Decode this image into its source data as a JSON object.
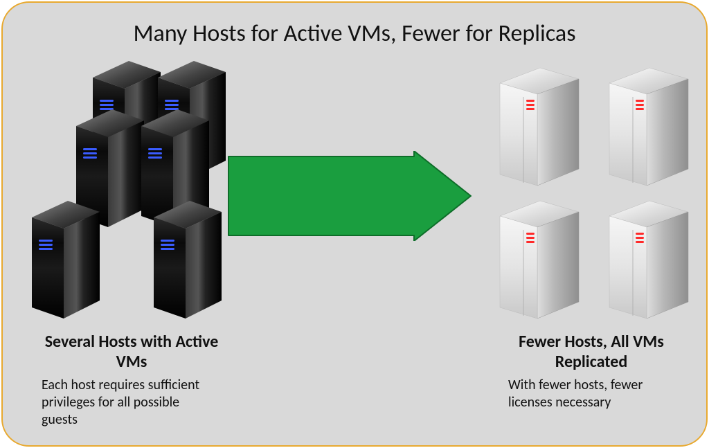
{
  "title": "Many Hosts for Active VMs, Fewer for Replicas",
  "left": {
    "heading": "Several Hosts with Active VMs",
    "sub": "Each host requires sufficient privileges for all possible guests"
  },
  "right": {
    "heading": "Fewer Hosts, All VMs Replicated",
    "sub": "With fewer hosts, fewer licenses necessary"
  },
  "arrow_color": "#1a9e3f",
  "servers": {
    "left_led": "#3a5cff",
    "right_led": "#ff2a2a"
  }
}
